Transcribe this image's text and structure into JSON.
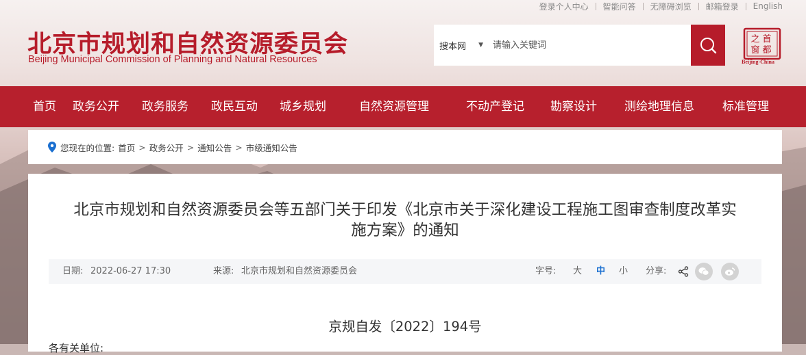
{
  "top_links": [
    "登录个人中心",
    "智能问答",
    "无障碍浏览",
    "邮箱登录",
    "English"
  ],
  "logo": {
    "cn": "北京市规划和自然资源委员会",
    "en": "Beijing Municipal Commission of Planning and Natural Resources"
  },
  "search": {
    "scope": "搜本网",
    "placeholder": "请输入关键词",
    "button_icon": "search-icon"
  },
  "seal": {
    "chars": [
      "首",
      "都",
      "之",
      "窗"
    ],
    "caption": "Beijing-China"
  },
  "nav": [
    "首页",
    "政务公开",
    "政务服务",
    "政民互动",
    "城乡规划",
    "自然资源管理",
    "不动产登记",
    "勘察设计",
    "测绘地理信息",
    "标准管理"
  ],
  "breadcrumb": {
    "prefix": "您现在的位置:",
    "items": [
      "首页",
      "政务公开",
      "通知公告",
      "市级通知公告"
    ],
    "separator": ">"
  },
  "article": {
    "title_line1": "北京市规划和自然资源委员会等五部门关于印发《北京市关于深化建设工程施工图审查制度改革实",
    "title_line2": "施方案》的通知",
    "date_label": "日期:",
    "date": "2022-06-27 17:30",
    "source_label": "来源:",
    "source": "北京市规划和自然资源委员会",
    "font_label": "字号:",
    "font_sizes": [
      "大",
      "中",
      "小"
    ],
    "font_active": "中",
    "share_label": "分享:",
    "doc_number": "京规自发〔2022〕194号",
    "cut_text": "各有关单位:"
  },
  "colors": {
    "brand_red": "#b61c2a",
    "nav_red": "#b7202d",
    "active_font": "#1a6fd0"
  }
}
